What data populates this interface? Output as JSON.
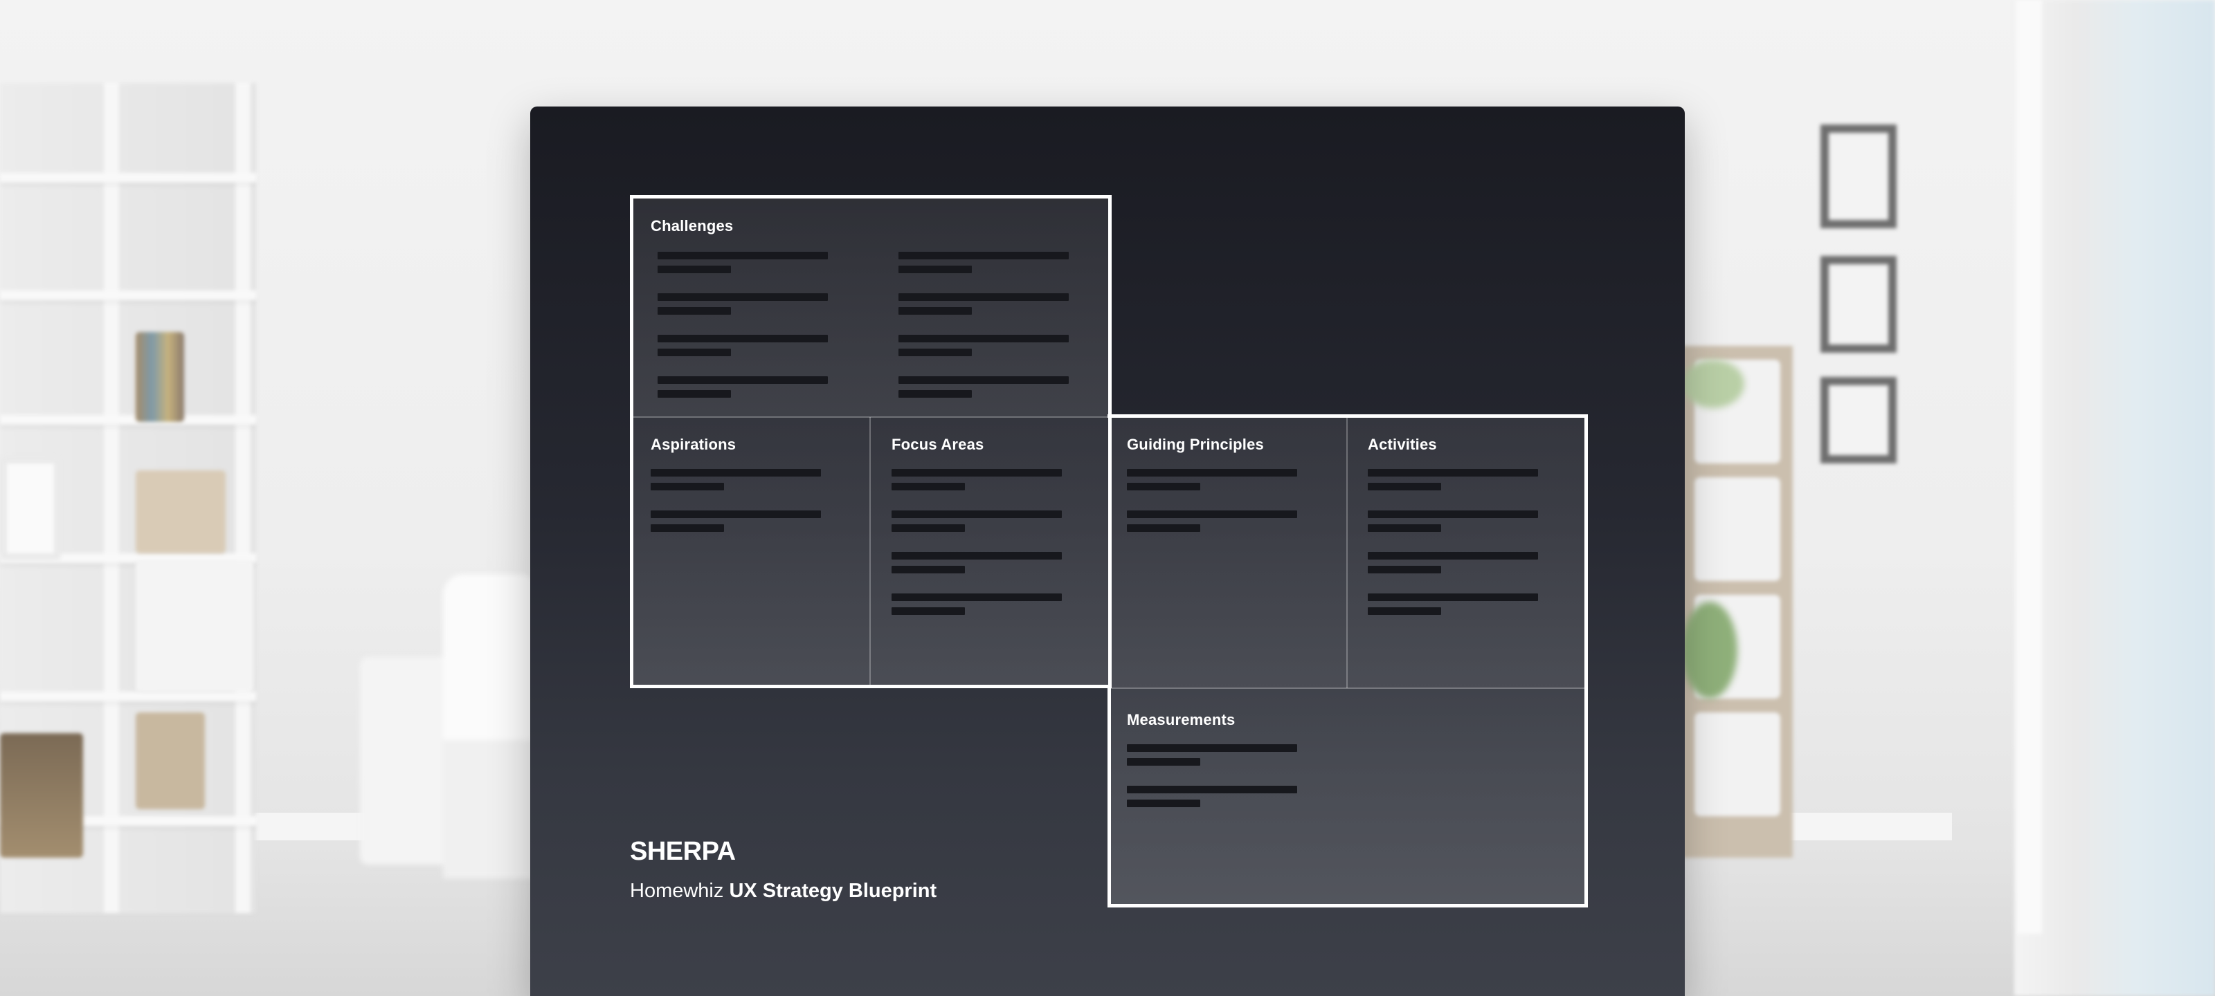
{
  "canvas": {
    "sections": {
      "challenges": {
        "title": "Challenges"
      },
      "aspirations": {
        "title": "Aspirations"
      },
      "focus_areas": {
        "title": "Focus Areas"
      },
      "guiding_principles": {
        "title": "Guiding Principles"
      },
      "activities": {
        "title": "Activities"
      },
      "measurements": {
        "title": "Measurements"
      }
    }
  },
  "footer": {
    "logo": "SHERPA",
    "project_name": "Homewhiz",
    "document_title": "UX Strategy Blueprint"
  },
  "colors": {
    "card_top": "#1a1b22",
    "card_bottom": "#3d4049",
    "outline": "#ffffff",
    "placeholder_bar": "#17181d"
  }
}
